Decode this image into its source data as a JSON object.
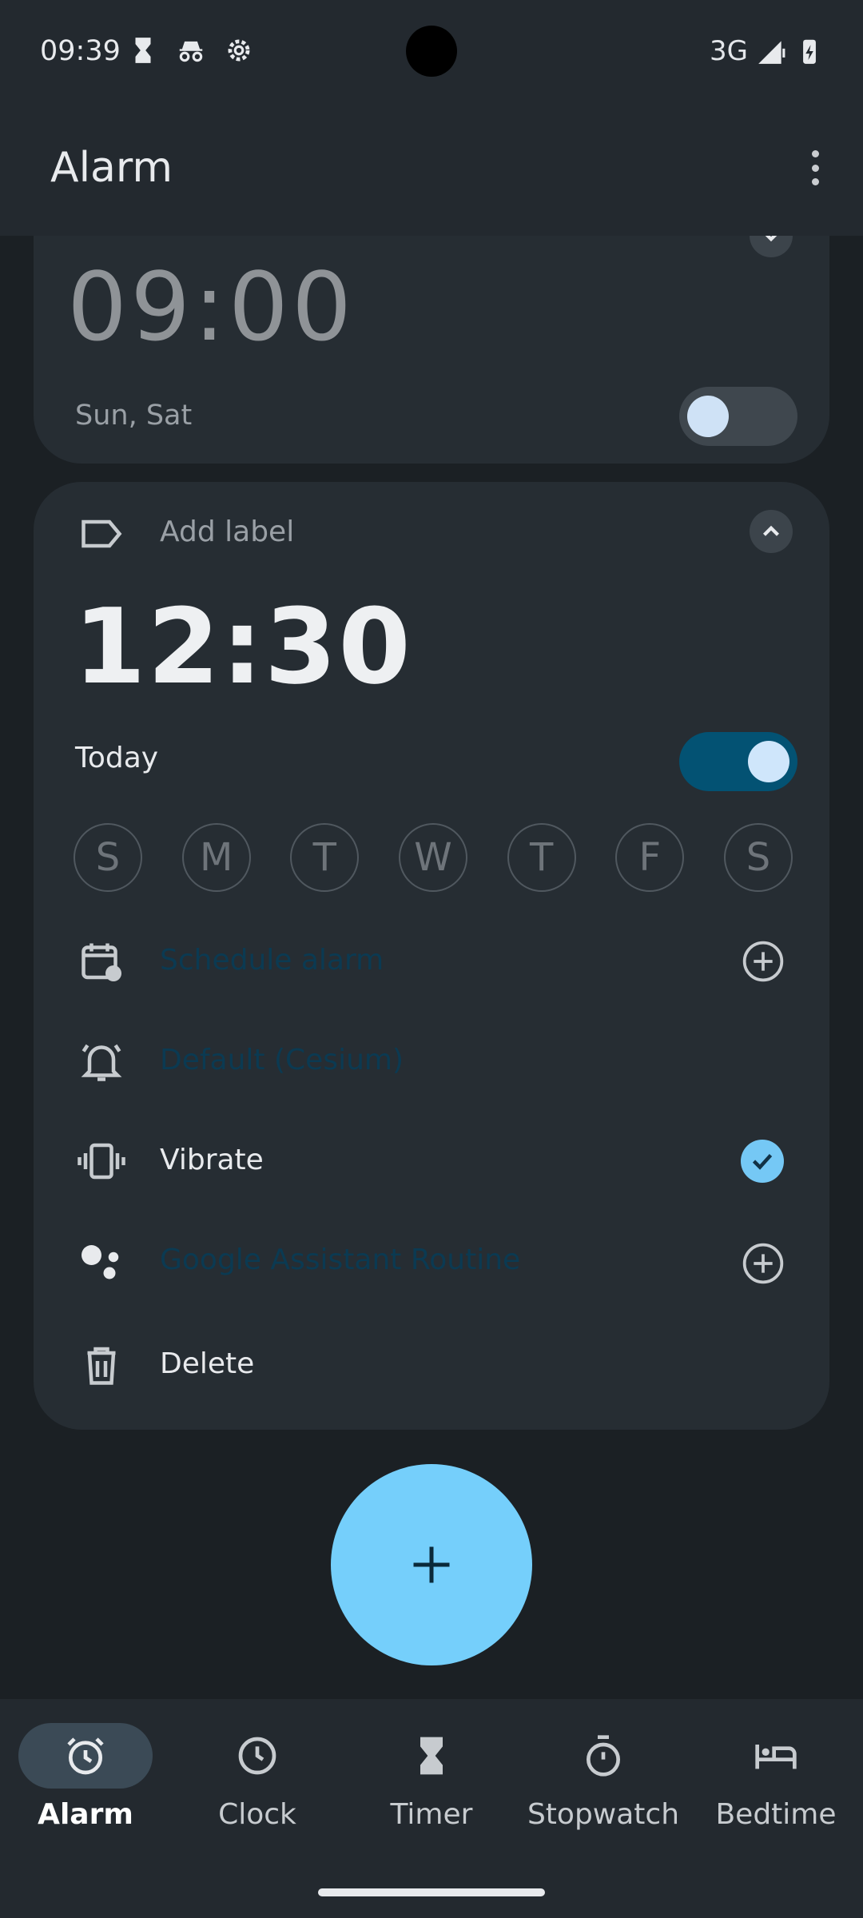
{
  "status_bar": {
    "time": "09:39",
    "network": "3G",
    "icons": [
      "hourglass-icon",
      "incognito-icon",
      "settings-gear-icon",
      "signal-icon",
      "battery-charging-icon"
    ]
  },
  "app_bar": {
    "title": "Alarm",
    "menu_icon": "more-vert-icon"
  },
  "alarms": [
    {
      "time": "09:00",
      "repeat": "Sun, Sat",
      "enabled": false,
      "expanded": false
    },
    {
      "label_placeholder": "Add label",
      "time": "12:30",
      "repeat": "Today",
      "enabled": true,
      "expanded": true,
      "weekdays": [
        "S",
        "M",
        "T",
        "W",
        "T",
        "F",
        "S"
      ],
      "schedule_label": "Schedule alarm",
      "sound_label": "Default (Cesium)",
      "vibrate_label": "Vibrate",
      "vibrate_checked": true,
      "assistant_label": "Google Assistant Routine",
      "delete_label": "Delete"
    }
  ],
  "fab": {
    "icon": "add-icon"
  },
  "bottom_nav": [
    {
      "label": "Alarm",
      "icon": "alarm-clock-icon",
      "active": true
    },
    {
      "label": "Clock",
      "icon": "clock-icon",
      "active": false
    },
    {
      "label": "Timer",
      "icon": "hourglass-icon",
      "active": false
    },
    {
      "label": "Stopwatch",
      "icon": "stopwatch-icon",
      "active": false
    },
    {
      "label": "Bedtime",
      "icon": "bed-icon",
      "active": false
    }
  ],
  "colors": {
    "background": "#1b2024",
    "card": "#262d33",
    "accent": "#75cffb",
    "toggle_on": "#035273"
  }
}
